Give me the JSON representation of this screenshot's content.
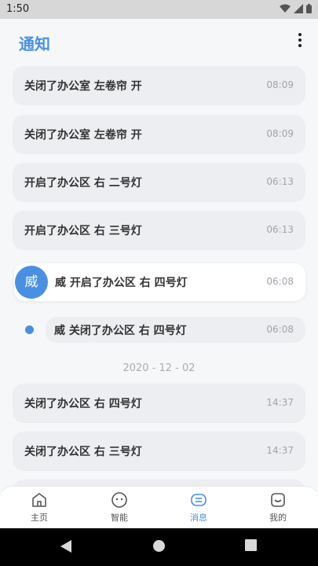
{
  "status": {
    "time": "1:50",
    "icons": [
      "wifi-icon",
      "signal-icon",
      "battery-icon"
    ]
  },
  "header": {
    "title": "通知",
    "menu_icon": "more-vert-icon"
  },
  "notifications": [
    {
      "text": "关闭了办公室  左卷帘 开",
      "time": "08:09"
    },
    {
      "text": "关闭了办公室  左卷帘 开",
      "time": "08:09"
    },
    {
      "text": "开启了办公区  右 二号灯",
      "time": "06:13"
    },
    {
      "text": "开启了办公区  右 三号灯",
      "time": "06:13"
    }
  ],
  "avatar_message": {
    "avatar": "威",
    "text": "威  开启了办公区  右 四号灯",
    "time": "06:08"
  },
  "dot_message": {
    "text": "威  关闭了办公区  右 四号灯",
    "time": "06:08"
  },
  "date_separator": "2020 - 12 - 02",
  "notifications_after": [
    {
      "text": "关闭了办公区  右 四号灯",
      "time": "14:37"
    },
    {
      "text": "关闭了办公区  右 三号灯",
      "time": "14:37"
    }
  ],
  "tabs": [
    {
      "label": "主页",
      "icon": "home-icon"
    },
    {
      "label": "智能",
      "icon": "smart-face-icon"
    },
    {
      "label": "消息",
      "icon": "message-icon",
      "active": true
    },
    {
      "label": "我的",
      "icon": "profile-icon"
    }
  ],
  "colors": {
    "accent": "#4a90e2",
    "card": "#eceef1",
    "background": "#f6f7f9"
  }
}
